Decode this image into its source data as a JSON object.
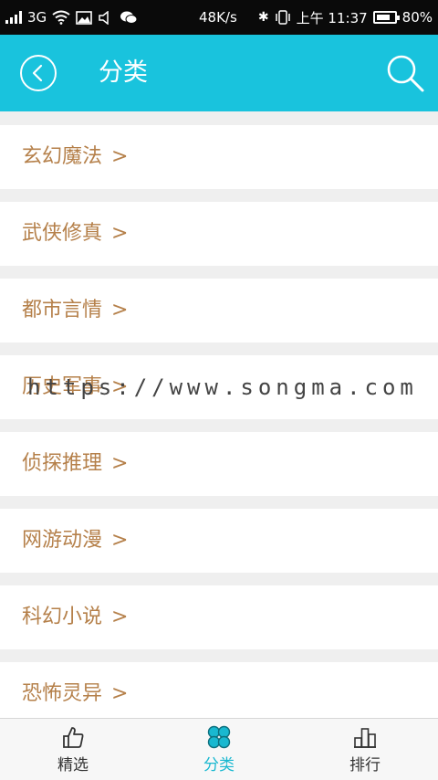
{
  "status_bar": {
    "network": "3G",
    "speed": "48K/s",
    "time": "上午 11:37",
    "battery": "80%",
    "battery_level": 0.8
  },
  "header": {
    "title": "分类",
    "back_icon": "back-circle-icon",
    "search_icon": "search-icon",
    "background": "#19c3dd"
  },
  "categories": [
    {
      "label": "玄幻魔法",
      "arrow": ">"
    },
    {
      "label": "武侠修真",
      "arrow": ">"
    },
    {
      "label": "都市言情",
      "arrow": ">"
    },
    {
      "label": "历史军事",
      "arrow": ">"
    },
    {
      "label": "侦探推理",
      "arrow": ">"
    },
    {
      "label": "网游动漫",
      "arrow": ">"
    },
    {
      "label": "科幻小说",
      "arrow": ">"
    },
    {
      "label": "恐怖灵异",
      "arrow": ">"
    }
  ],
  "watermark": "https://www.songma.com",
  "tabs": [
    {
      "label": "精选",
      "icon": "thumbs-up-icon",
      "active": false
    },
    {
      "label": "分类",
      "icon": "clover-icon",
      "active": true
    },
    {
      "label": "排行",
      "icon": "podium-icon",
      "active": false
    }
  ],
  "colors": {
    "accent": "#19c3dd",
    "category_text": "#b5804a",
    "active_tab": "#19b8d0"
  }
}
